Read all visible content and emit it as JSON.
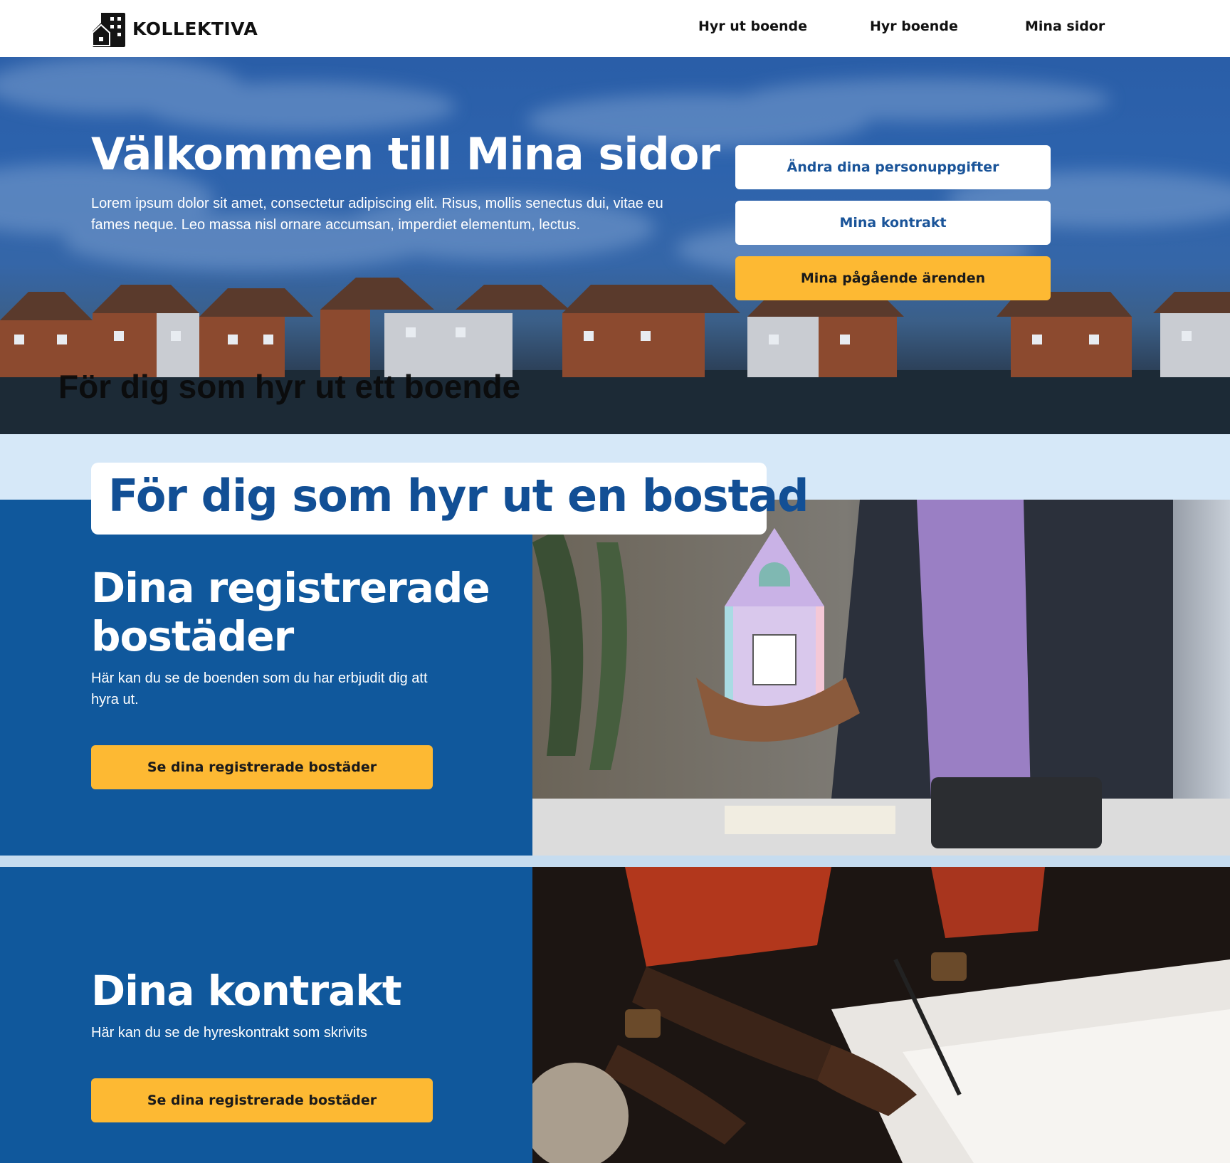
{
  "brand": {
    "name": "KOLLEKTIVA",
    "icon": "building-icon"
  },
  "nav": {
    "items": [
      {
        "label": "Hyr ut boende"
      },
      {
        "label": "Hyr boende"
      },
      {
        "label": "Mina sidor"
      }
    ]
  },
  "hero": {
    "title": "Välkommen till Mina sidor",
    "text": "Lorem ipsum dolor sit amet, consectetur adipiscing elit. Risus, mollis senectus dui, vitae eu fames neque. Leo massa nisl ornare accumsan, imperdiet elementum, lectus.",
    "buttons": [
      {
        "label": "Ändra dina personuppgifter"
      },
      {
        "label": "Mina kontrakt"
      },
      {
        "label": "Mina pågående ärenden"
      }
    ],
    "overlay_heading": "För dig som hyr ut ett boende"
  },
  "section_title": "För dig som hyr ut en bostad",
  "registered": {
    "title_line1": "Dina registrerade",
    "title_line2": "bostäder",
    "text": "Här kan du se de boenden som du har erbjudit dig att hyra ut.",
    "button": "Se dina registrerade bostäder"
  },
  "contracts": {
    "title": "Dina kontrakt",
    "text": "Här kan du se de hyreskontrakt som skrivits",
    "button": "Se dina registrerade bostäder"
  },
  "colors": {
    "primary_blue": "#10589c",
    "accent_yellow": "#fdb933",
    "light_blue": "#d6e8f8",
    "title_blue": "#124f95"
  }
}
